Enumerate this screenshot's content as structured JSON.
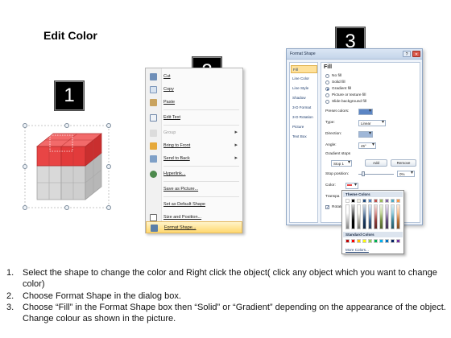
{
  "slide": {
    "title": "Edit Color",
    "steps": [
      "1",
      "2",
      "3"
    ]
  },
  "context_menu": {
    "items": [
      {
        "label": "Cut",
        "icon": "scissors-icon",
        "disabled": false
      },
      {
        "label": "Copy",
        "icon": "copy-icon",
        "disabled": false
      },
      {
        "label": "Paste",
        "icon": "paste-icon",
        "disabled": false
      },
      {
        "label": "Edit Text",
        "icon": "edit-text-icon",
        "disabled": false
      },
      {
        "label": "Group",
        "icon": "group-icon",
        "disabled": true,
        "submenu": true
      },
      {
        "label": "Bring to Front",
        "icon": "bring-to-front-icon",
        "disabled": false,
        "submenu": true
      },
      {
        "label": "Send to Back",
        "icon": "send-to-back-icon",
        "disabled": false,
        "submenu": true
      },
      {
        "label": "Hyperlink...",
        "icon": "hyperlink-icon",
        "disabled": false
      },
      {
        "label": "Save as Picture...",
        "icon": "",
        "disabled": false
      },
      {
        "label": "Set as Default Shape",
        "icon": "",
        "disabled": false
      },
      {
        "label": "Size and Position...",
        "icon": "size-position-icon",
        "disabled": false
      },
      {
        "label": "Format Shape...",
        "icon": "format-shape-icon",
        "disabled": false,
        "highlighted": true
      }
    ]
  },
  "format_dialog": {
    "title": "Format Shape",
    "categories": [
      "Fill",
      "Line Color",
      "Line Style",
      "Shadow",
      "3-D Format",
      "3-D Rotation",
      "Picture",
      "Text Box"
    ],
    "selected_category": "Fill",
    "fill": {
      "heading": "Fill",
      "options": [
        "No fill",
        "Solid fill",
        "Gradient fill",
        "Picture or texture fill",
        "Slide background fill"
      ],
      "selected_option": "Gradient fill",
      "preset_colors_label": "Preset colors:",
      "type_label": "Type:",
      "type_value": "Linear",
      "direction_label": "Direction:",
      "angle_label": "Angle:",
      "angle_value": "45°",
      "gradient_stops_label": "Gradient stops",
      "stop_value": "Stop 1",
      "add_button": "Add",
      "remove_button": "Remove",
      "stop_position_label": "Stop position:",
      "stop_position_value": "0%",
      "color_label": "Color:",
      "transparency_label": "Transpa",
      "rotate_label": "Rotate",
      "rotate_checked": true
    }
  },
  "color_popup": {
    "theme_header": "Theme Colors",
    "standard_header": "Standard Colors",
    "more_link": "More Colors...",
    "theme_top_row": [
      "#ffffff",
      "#000000",
      "#eeece1",
      "#1f497d",
      "#4f81bd",
      "#c0504d",
      "#9bbb59",
      "#8064a2",
      "#4bacc6",
      "#f79646"
    ],
    "standard_colors": [
      "#c00000",
      "#ff0000",
      "#ffc000",
      "#ffff00",
      "#92d050",
      "#00b050",
      "#00b0f0",
      "#0070c0",
      "#002060",
      "#7030a0"
    ]
  },
  "instructions": [
    {
      "num": "1.",
      "text": "Select the shape to change the color and Right click the object( click any object which you want to change color)"
    },
    {
      "num": "2.",
      "text": "Choose Format Shape in the dialog box."
    },
    {
      "num": "3.",
      "text": "Choose “Fill” in the Format Shape box then “Solid” or “Gradient” depending on the appearance of the object. Change colour as shown in the picture."
    }
  ],
  "colors": {
    "cube_top": "#e84545",
    "cube_bottom": "#c8c8c8",
    "menu_highlight": "#ffd86f"
  }
}
